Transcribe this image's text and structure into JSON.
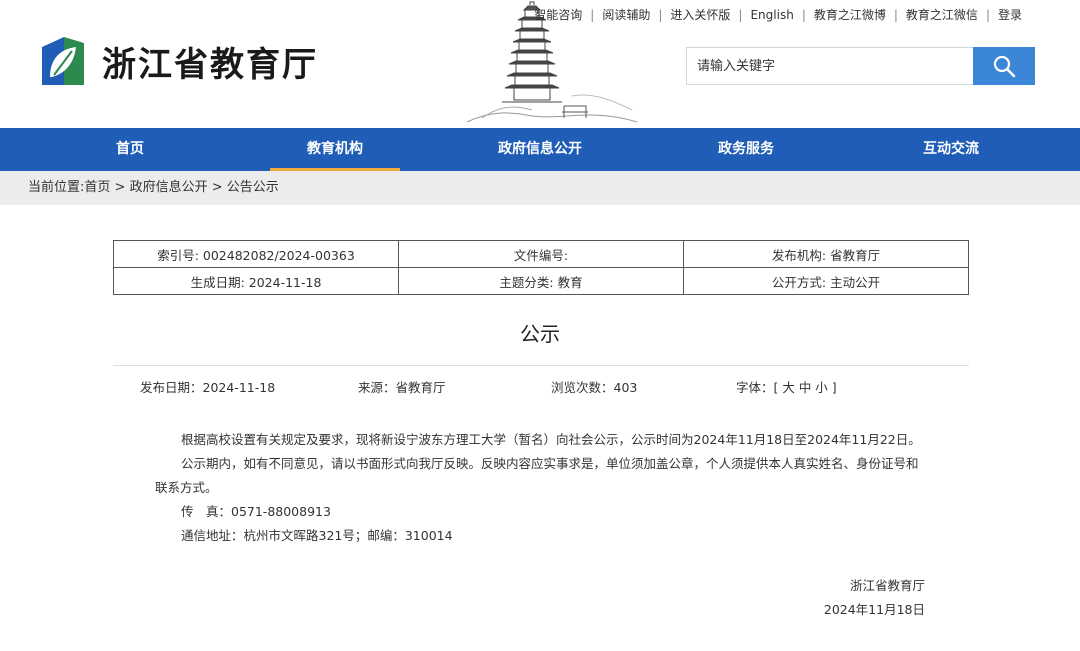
{
  "header": {
    "site_name": "浙江省教育厅",
    "top_links": [
      "智能咨询",
      "阅读辅助",
      "进入关怀版",
      "English",
      "教育之江微博",
      "教育之江微信",
      "登录"
    ],
    "search": {
      "placeholder": "请输入关键字"
    }
  },
  "nav": {
    "items": [
      "首页",
      "教育机构",
      "政府信息公开",
      "政务服务",
      "互动交流"
    ],
    "active": "教育机构"
  },
  "breadcrumb": {
    "prefix": "当前位置:",
    "items": [
      "首页",
      "政府信息公开",
      "公告公示"
    ],
    "separator": ">"
  },
  "meta": {
    "row1": [
      "索引号: 002482082/2024-00363",
      "文件编号:",
      "发布机构: 省教育厅"
    ],
    "row2": [
      "生成日期: 2024-11-18",
      "主题分类: 教育",
      "公开方式: 主动公开"
    ]
  },
  "article": {
    "title": "公示",
    "publish_date": "发布日期：2024-11-18",
    "source": "来源：省教育厅",
    "views": "浏览次数：403",
    "font_size": "字体：[ 大 中 小 ]",
    "paragraphs": [
      "根据高校设置有关规定及要求，现将新设宁波东方理工大学（暂名）向社会公示，公示时间为2024年11月18日至2024年11月22日。",
      "公示期内，如有不同意见，请以书面形式向我厅反映。反映内容应实事求是，单位须加盖公章，个人须提供本人真实姓名、身份证号和联系方式。",
      "传　真：0571-88008913",
      "通信地址：杭州市文晖路321号；邮编：310014"
    ],
    "signature": "浙江省教育厅",
    "sign_date": "2024年11月18日"
  },
  "colors": {
    "nav_bg": "#1f5db7",
    "nav_active_underline": "#f0a93a",
    "search_button": "#3b86d6",
    "breadcrumb_bg": "#ececec"
  }
}
